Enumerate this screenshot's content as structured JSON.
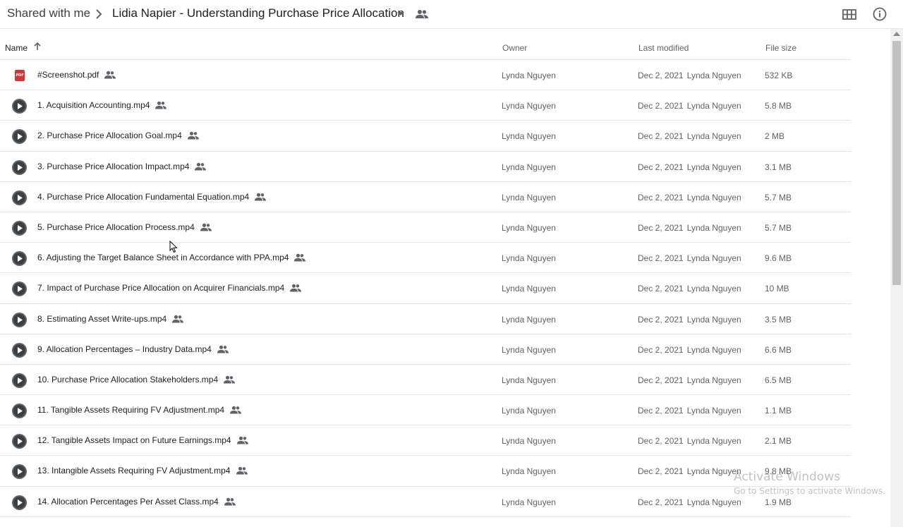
{
  "breadcrumb": {
    "root": "Shared with me",
    "current": "Lidia Napier - Understanding Purchase Price Allocation"
  },
  "columns": {
    "name": "Name",
    "owner": "Owner",
    "last_modified": "Last modified",
    "file_size": "File size"
  },
  "files": [
    {
      "name": "#Screenshot.pdf",
      "type": "pdf",
      "owner": "Lynda Nguyen",
      "date": "Dec 2, 2021",
      "modified_by": "Lynda Nguyen",
      "size": "532 KB"
    },
    {
      "name": "1. Acquisition Accounting.mp4",
      "type": "video",
      "owner": "Lynda Nguyen",
      "date": "Dec 2, 2021",
      "modified_by": "Lynda Nguyen",
      "size": "5.8 MB"
    },
    {
      "name": "2. Purchase Price Allocation Goal.mp4",
      "type": "video",
      "owner": "Lynda Nguyen",
      "date": "Dec 2, 2021",
      "modified_by": "Lynda Nguyen",
      "size": "2 MB"
    },
    {
      "name": "3. Purchase Price Allocation Impact.mp4",
      "type": "video",
      "owner": "Lynda Nguyen",
      "date": "Dec 2, 2021",
      "modified_by": "Lynda Nguyen",
      "size": "3.1 MB"
    },
    {
      "name": "4. Purchase Price Allocation Fundamental Equation.mp4",
      "type": "video",
      "owner": "Lynda Nguyen",
      "date": "Dec 2, 2021",
      "modified_by": "Lynda Nguyen",
      "size": "5.7 MB"
    },
    {
      "name": "5. Purchase Price Allocation Process.mp4",
      "type": "video",
      "owner": "Lynda Nguyen",
      "date": "Dec 2, 2021",
      "modified_by": "Lynda Nguyen",
      "size": "5.7 MB"
    },
    {
      "name": "6. Adjusting the Target Balance Sheet in Accordance with PPA.mp4",
      "type": "video",
      "owner": "Lynda Nguyen",
      "date": "Dec 2, 2021",
      "modified_by": "Lynda Nguyen",
      "size": "9.6 MB"
    },
    {
      "name": "7. Impact of Purchase Price Allocation on Acquirer Financials.mp4",
      "type": "video",
      "owner": "Lynda Nguyen",
      "date": "Dec 2, 2021",
      "modified_by": "Lynda Nguyen",
      "size": "10 MB"
    },
    {
      "name": "8. Estimating Asset Write-ups.mp4",
      "type": "video",
      "owner": "Lynda Nguyen",
      "date": "Dec 2, 2021",
      "modified_by": "Lynda Nguyen",
      "size": "3.5 MB"
    },
    {
      "name": "9. Allocation Percentages – Industry Data.mp4",
      "type": "video",
      "owner": "Lynda Nguyen",
      "date": "Dec 2, 2021",
      "modified_by": "Lynda Nguyen",
      "size": "6.6 MB"
    },
    {
      "name": "10. Purchase Price Allocation Stakeholders.mp4",
      "type": "video",
      "owner": "Lynda Nguyen",
      "date": "Dec 2, 2021",
      "modified_by": "Lynda Nguyen",
      "size": "6.5 MB"
    },
    {
      "name": "11. Tangible Assets Requiring FV Adjustment.mp4",
      "type": "video",
      "owner": "Lynda Nguyen",
      "date": "Dec 2, 2021",
      "modified_by": "Lynda Nguyen",
      "size": "1.1 MB"
    },
    {
      "name": "12. Tangible Assets Impact on Future Earnings.mp4",
      "type": "video",
      "owner": "Lynda Nguyen",
      "date": "Dec 2, 2021",
      "modified_by": "Lynda Nguyen",
      "size": "2.1 MB"
    },
    {
      "name": "13. Intangible Assets Requiring FV Adjustment.mp4",
      "type": "video",
      "owner": "Lynda Nguyen",
      "date": "Dec 2, 2021",
      "modified_by": "Lynda Nguyen",
      "size": "9.8 MB"
    },
    {
      "name": "14. Allocation Percentages Per Asset Class.mp4",
      "type": "video",
      "owner": "Lynda Nguyen",
      "date": "Dec 2, 2021",
      "modified_by": "Lynda Nguyen",
      "size": "1.9 MB"
    }
  ],
  "pdf_badge": "PDF",
  "watermark": {
    "line1": "Activate Windows",
    "line2": "Go to Settings to activate Windows."
  },
  "icons": {
    "sort": "arrow-up-icon",
    "shared": "people-icon",
    "video": "play-circle-icon",
    "pdf": "pdf-icon",
    "grid": "grid-view-icon",
    "info": "info-icon"
  },
  "colors": {
    "pdf_red": "#db3236",
    "play_dark": "#5f6368",
    "divider": "#e6e6e6"
  }
}
